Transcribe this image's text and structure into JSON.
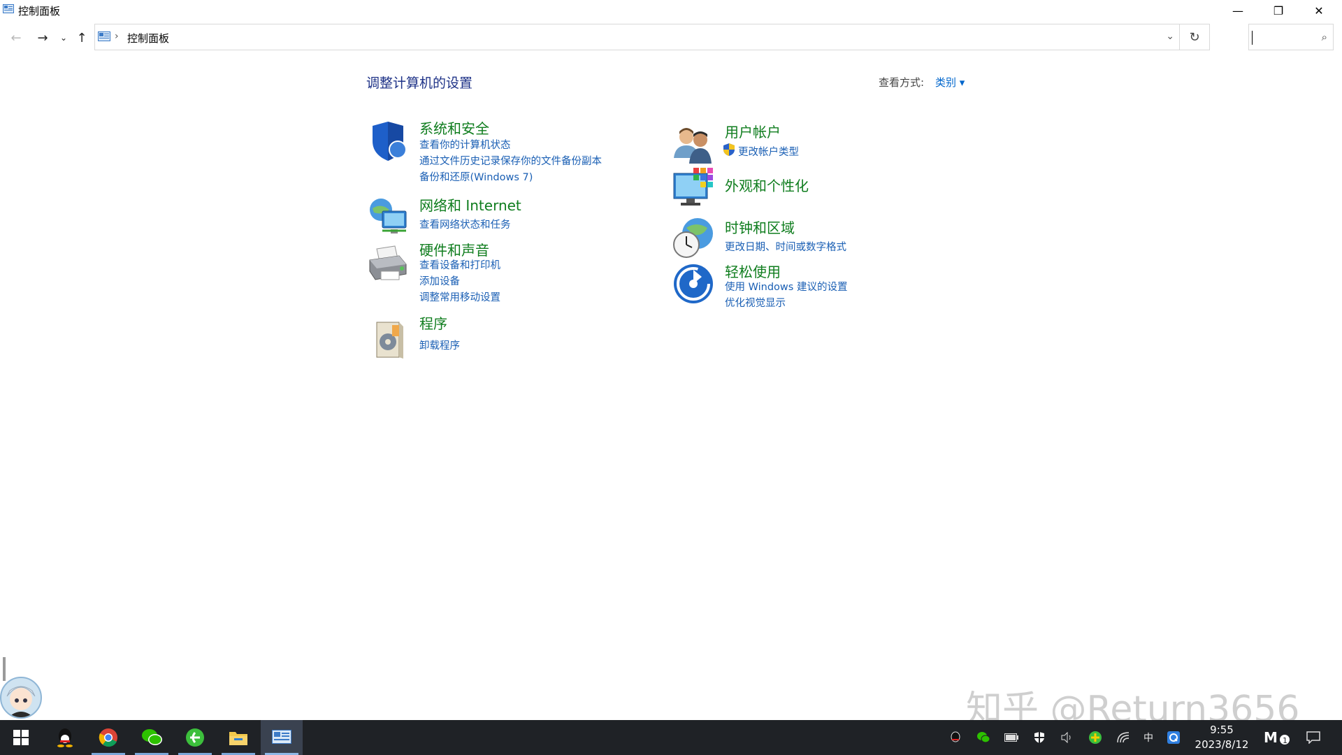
{
  "window": {
    "title": "控制面板",
    "minimize_glyph": "—",
    "maximize_glyph": "❐",
    "close_glyph": "✕"
  },
  "address": {
    "crumb": "控制面板",
    "separator": "›",
    "search_placeholder": ""
  },
  "page": {
    "heading": "调整计算机的设置",
    "view_by_label": "查看方式:",
    "view_by_value": "类别 ▾"
  },
  "categories": [
    {
      "title": "系统和安全",
      "icon": "shield-icon",
      "links": [
        "查看你的计算机状态",
        "通过文件历史记录保存你的文件备份副本",
        "备份和还原(Windows 7)"
      ]
    },
    {
      "title": "网络和 Internet",
      "icon": "network-icon",
      "links": [
        "查看网络状态和任务"
      ]
    },
    {
      "title": "硬件和声音",
      "icon": "printer-icon",
      "links": [
        "查看设备和打印机",
        "添加设备",
        "调整常用移动设置"
      ]
    },
    {
      "title": "程序",
      "icon": "programs-icon",
      "links": [
        "卸载程序"
      ]
    },
    {
      "title": "用户帐户",
      "icon": "users-icon",
      "links": [
        "更改帐户类型"
      ]
    },
    {
      "title": "外观和个性化",
      "icon": "appearance-icon",
      "links": []
    },
    {
      "title": "时钟和区域",
      "icon": "clock-globe-icon",
      "links": [
        "更改日期、时间或数字格式"
      ]
    },
    {
      "title": "轻松使用",
      "icon": "ease-of-access-icon",
      "links": [
        "使用 Windows 建议的设置",
        "优化视觉显示"
      ]
    }
  ],
  "taskbar": {
    "apps": [
      "start-icon",
      "qq-icon",
      "chrome-icon",
      "wechat-icon",
      "browser-icon",
      "file-explorer-icon",
      "control-panel-icon"
    ],
    "ime": "中",
    "time": "9:55",
    "date": "2023/8/12"
  },
  "watermark": "知乎 @Return3656",
  "colors": {
    "heading": "#1e3287",
    "category_title": "#0f7d1e",
    "link": "#1a5fb4",
    "taskbar": "#1f2226"
  }
}
